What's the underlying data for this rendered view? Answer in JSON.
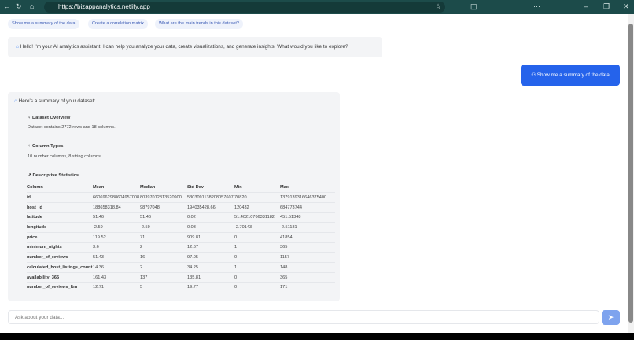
{
  "browser": {
    "url": "https://bizappanalytics.netlify.app"
  },
  "suggestions": [
    "Show me a summary of the data",
    "Create a correlation matrix",
    "What are the main trends in this dataset?"
  ],
  "greeting": "Hello! I'm your AI analytics assistant. I can help you analyze your data, create visualizations, and generate insights. What would you like to explore?",
  "user_message": "Show me a summary of the data",
  "summary": {
    "intro": "Here's a summary of your dataset:",
    "overview_title": "Dataset Overview",
    "overview_text": "Dataset contains 2772 rows and 18 columns.",
    "types_title": "Column Types",
    "types_text": "10 number columns, 8 string columns",
    "stats_title": "Descriptive Statistics",
    "headers": [
      "Column",
      "Mean",
      "Median",
      "Std Dev",
      "Min",
      "Max"
    ],
    "rows": [
      [
        "id",
        "6606962988604957008",
        "80397012813520900",
        "5303091138208057607",
        "70820",
        "1379139316646375400"
      ],
      [
        "host_id",
        "188658318.84",
        "98797048",
        "194035428.66",
        "120432",
        "684773744"
      ],
      [
        "latitude",
        "51.46",
        "51.46",
        "0.02",
        "51.40210766331182",
        "451.51348"
      ],
      [
        "longitude",
        "-2.59",
        "-2.59",
        "0.03",
        "-2.70143",
        "-2.51181"
      ],
      [
        "price",
        "119.52",
        "71",
        "909.81",
        "0",
        "41854"
      ],
      [
        "minimum_nights",
        "3.6",
        "2",
        "12.67",
        "1",
        "365"
      ],
      [
        "number_of_reviews",
        "51.43",
        "16",
        "97.05",
        "0",
        "1157"
      ],
      [
        "calculated_host_listings_count",
        "14.36",
        "2",
        "34.25",
        "1",
        "148"
      ],
      [
        "availability_365",
        "161.43",
        "137",
        "135.81",
        "0",
        "365"
      ],
      [
        "number_of_reviews_ltm",
        "12.71",
        "5",
        "19.77",
        "0",
        "171"
      ]
    ]
  },
  "input": {
    "placeholder": "Ask about your data..."
  },
  "colors": {
    "accent": "#2563eb",
    "send": "#7ea3ee",
    "topbar": "#1c4b4a"
  }
}
